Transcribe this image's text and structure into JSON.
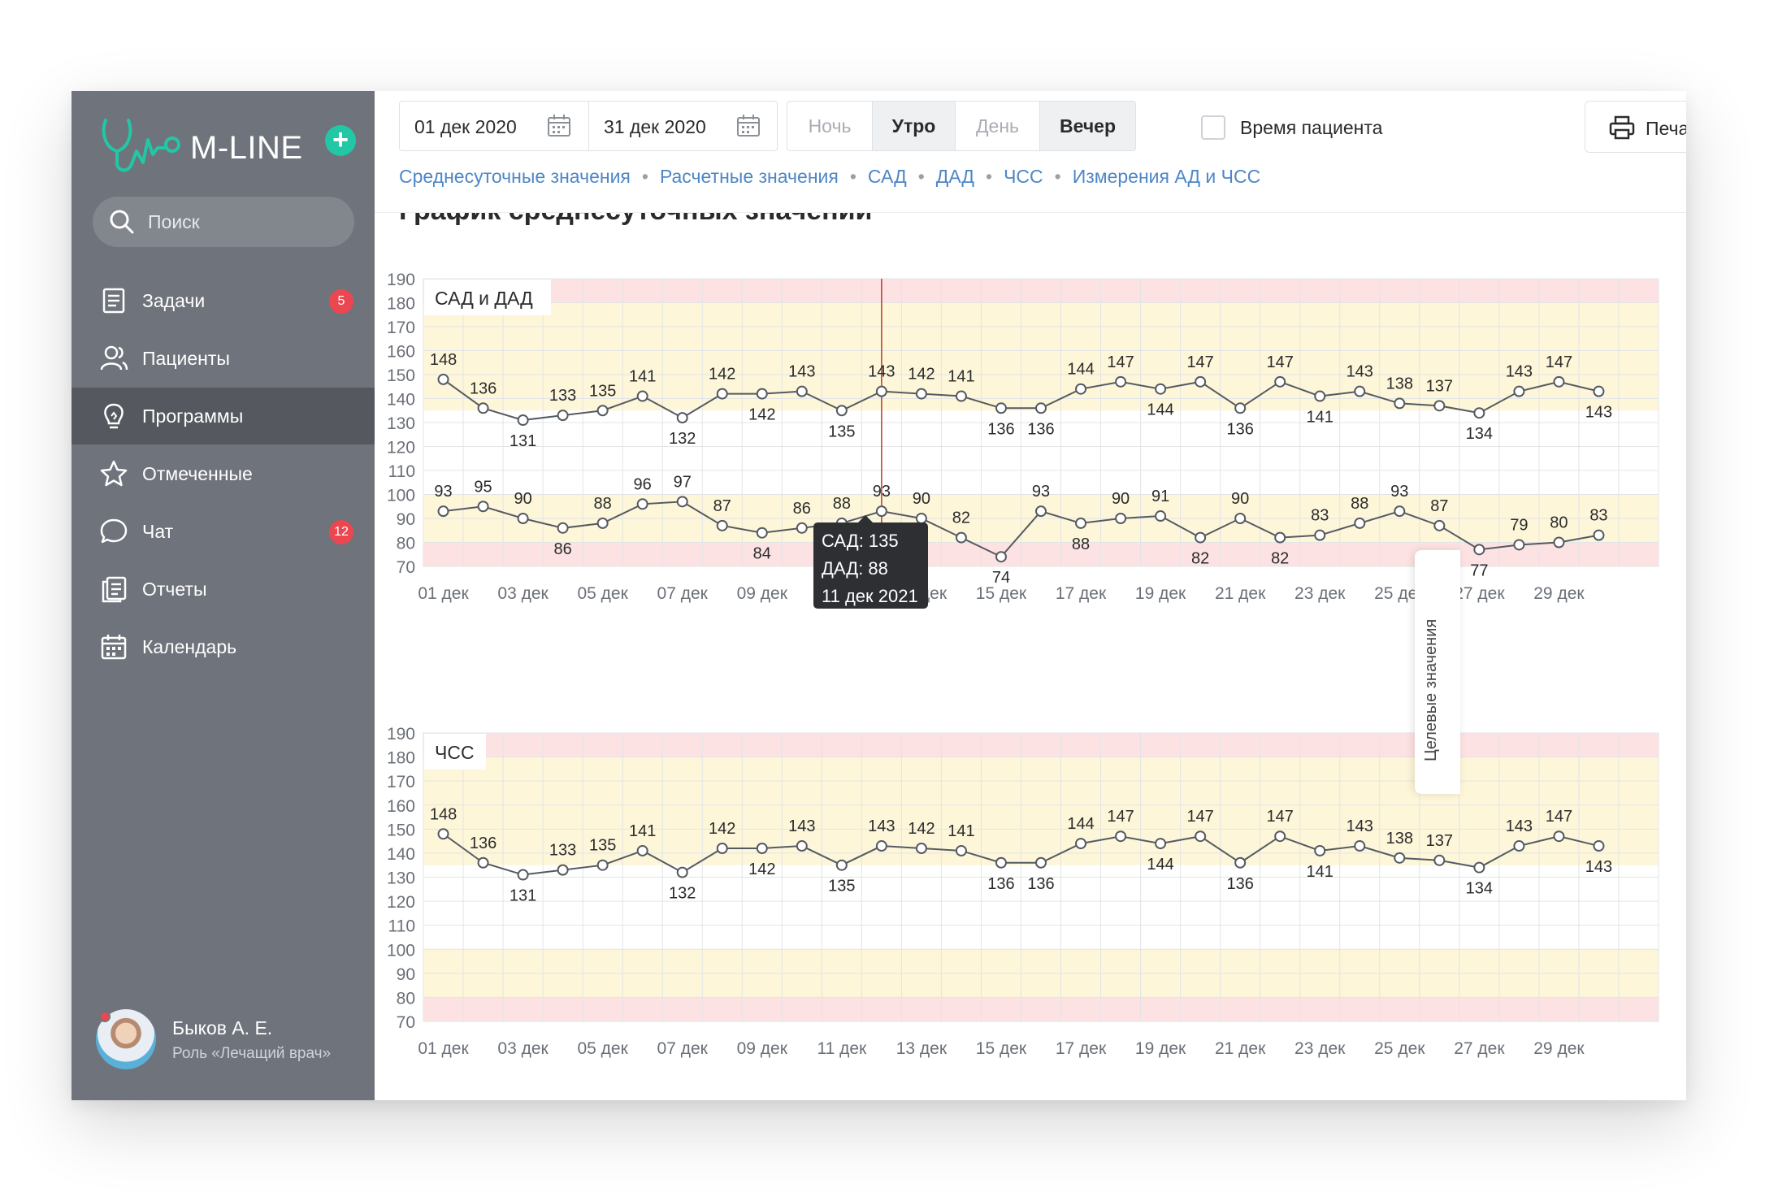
{
  "app": {
    "logo_text": "M-LINE"
  },
  "sidebar": {
    "search_placeholder": "Поиск",
    "items": [
      {
        "label": "Задачи",
        "icon": "document-icon",
        "badge": "5"
      },
      {
        "label": "Пациенты",
        "icon": "users-icon",
        "badge": ""
      },
      {
        "label": "Программы",
        "icon": "lightbulb-icon",
        "badge": "",
        "active": true
      },
      {
        "label": "Отмеченные",
        "icon": "star-icon",
        "badge": ""
      },
      {
        "label": "Чат",
        "icon": "chat-icon",
        "badge": "12"
      },
      {
        "label": "Отчеты",
        "icon": "report-icon",
        "badge": ""
      },
      {
        "label": "Календарь",
        "icon": "calendar-icon",
        "badge": ""
      }
    ],
    "user": {
      "name": "Быков А. Е.",
      "role": "Роль «Лечащий врач»"
    }
  },
  "toolbar": {
    "date_from": "01 дек 2020",
    "date_to": "31 дек 2020",
    "time_segments": [
      {
        "label": "Ночь",
        "selected": false
      },
      {
        "label": "Утро",
        "selected": true
      },
      {
        "label": "День",
        "selected": false
      },
      {
        "label": "Вечер",
        "selected": true
      }
    ],
    "patient_time_label": "Время пациента",
    "patient_time_checked": false,
    "print_label": "Печать"
  },
  "tabs": [
    "Среднесуточные значения",
    "Расчетные значения",
    "САД",
    "ДАД",
    "ЧСС",
    "Измерения АД и ЧСС"
  ],
  "page_title": "График среднесуточных значений",
  "target_values_label": "Целевые значения",
  "colors": {
    "accent": "#22c7a6",
    "badge": "#ec4751",
    "link": "#4f86c6",
    "sidebar": "#6f737b",
    "zone_red": "#fde2e3",
    "zone_yellow": "#fdf6d9",
    "cursor": "#c0392b"
  },
  "tooltip": {
    "line1": "САД: 135",
    "line2": "ДАД: 88",
    "line3": "11 дек 2021"
  },
  "chart_data": [
    {
      "type": "line",
      "title": "САД и ДАД",
      "ylim": [
        70,
        190
      ],
      "yticks": [
        190,
        180,
        170,
        160,
        150,
        140,
        130,
        120,
        110,
        100,
        90,
        80,
        70
      ],
      "x": [
        1,
        2,
        3,
        4,
        5,
        6,
        7,
        8,
        9,
        10,
        11,
        12,
        13,
        14,
        15,
        16,
        17,
        18,
        19,
        20,
        21,
        22,
        23,
        24,
        25,
        26,
        27,
        28,
        29,
        30,
        31
      ],
      "xtick_labels": [
        "01 дек",
        "03 дек",
        "05 дек",
        "07 дек",
        "09 дек",
        "11 дек",
        "13 дек",
        "15 дек",
        "17 дек",
        "19 дек",
        "21 дек",
        "23 дек",
        "25 дек",
        "27 дек",
        "29 дек"
      ],
      "grid": true,
      "series": [
        {
          "name": "САД",
          "values": [
            148,
            136,
            131,
            133,
            135,
            141,
            132,
            142,
            142,
            143,
            135,
            143,
            142,
            141,
            136,
            136,
            144,
            147,
            144,
            147,
            136,
            147,
            141,
            143,
            138,
            137,
            134,
            143,
            147,
            143
          ]
        },
        {
          "name": "ДАД",
          "values": [
            93,
            95,
            90,
            86,
            88,
            96,
            97,
            87,
            84,
            86,
            88,
            93,
            90,
            82,
            74,
            93,
            88,
            90,
            91,
            82,
            90,
            82,
            83,
            88,
            93,
            87,
            77,
            79,
            80,
            83
          ]
        }
      ],
      "zones": [
        {
          "from": 180,
          "to": 190,
          "color": "red"
        },
        {
          "from": 135,
          "to": 180,
          "color": "yellow"
        },
        {
          "from": 80,
          "to": 100,
          "color": "yellow"
        },
        {
          "from": 70,
          "to": 80,
          "color": "red"
        }
      ],
      "cursor_x": 12
    },
    {
      "type": "line",
      "title": "ЧСС",
      "ylim": [
        70,
        190
      ],
      "yticks": [
        190,
        180,
        170,
        160,
        150,
        140,
        130,
        120,
        110,
        100,
        90,
        80,
        70
      ],
      "x": [
        1,
        2,
        3,
        4,
        5,
        6,
        7,
        8,
        9,
        10,
        11,
        12,
        13,
        14,
        15,
        16,
        17,
        18,
        19,
        20,
        21,
        22,
        23,
        24,
        25,
        26,
        27,
        28,
        29,
        30,
        31
      ],
      "xtick_labels": [
        "01 дек",
        "03 дек",
        "05 дек",
        "07 дек",
        "09 дек",
        "11 дек",
        "13 дек",
        "15 дек",
        "17 дек",
        "19 дек",
        "21 дек",
        "23 дек",
        "25 дек",
        "27 дек",
        "29 дек"
      ],
      "grid": true,
      "series": [
        {
          "name": "ЧСС",
          "values": [
            148,
            136,
            131,
            133,
            135,
            141,
            132,
            142,
            142,
            143,
            135,
            143,
            142,
            141,
            136,
            136,
            144,
            147,
            144,
            147,
            136,
            147,
            141,
            143,
            138,
            137,
            134,
            143,
            147,
            143
          ]
        }
      ],
      "zones": [
        {
          "from": 180,
          "to": 190,
          "color": "red"
        },
        {
          "from": 135,
          "to": 180,
          "color": "yellow"
        },
        {
          "from": 80,
          "to": 100,
          "color": "yellow"
        },
        {
          "from": 70,
          "to": 80,
          "color": "red"
        }
      ]
    }
  ]
}
